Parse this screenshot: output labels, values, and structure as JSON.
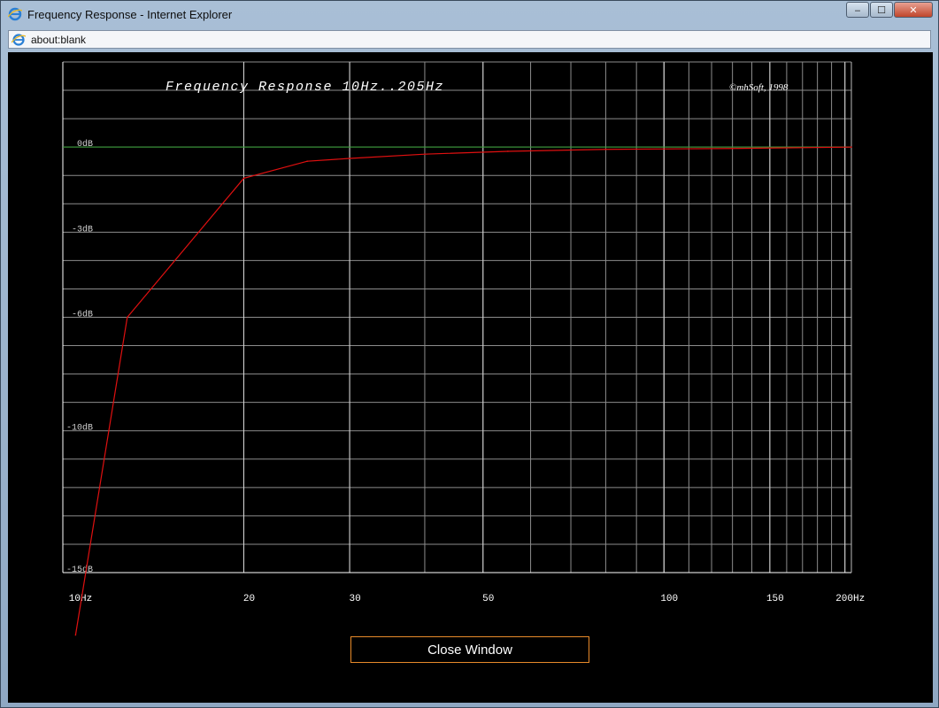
{
  "window": {
    "title": "Frequency Response - Internet Explorer",
    "address": "about:blank",
    "controls": {
      "minimize": "‒",
      "maximize": "☐",
      "close": "✕"
    }
  },
  "close_button": {
    "label": "Close Window"
  },
  "chart_data": {
    "type": "line",
    "title": "Frequency Response 10Hz..205Hz",
    "annotation": "©mhSoft, 1998",
    "x_scale": "log",
    "xlim": [
      10,
      205
    ],
    "ylim": [
      -15,
      3
    ],
    "x_ticks": [
      {
        "value": 10,
        "label": "10Hz"
      },
      {
        "value": 20,
        "label": "20"
      },
      {
        "value": 30,
        "label": "30"
      },
      {
        "value": 50,
        "label": "50"
      },
      {
        "value": 100,
        "label": "100"
      },
      {
        "value": 150,
        "label": "150"
      },
      {
        "value": 200,
        "label": "200Hz"
      }
    ],
    "y_ticks": [
      {
        "value": 0,
        "label": "0dB"
      },
      {
        "value": -3,
        "label": "-3dB"
      },
      {
        "value": -6,
        "label": "-6dB"
      },
      {
        "value": -10,
        "label": "-10dB"
      },
      {
        "value": -15,
        "label": "-15dB"
      }
    ],
    "reference_line": {
      "value": 0,
      "color": "#2e9a2e"
    },
    "grid": true,
    "grid_color": "#8c8c8c",
    "axis_color": "#ffffff",
    "series": [
      {
        "color": "#e01010",
        "x": [
          10.5,
          12.8,
          20,
          25.5,
          30,
          40,
          55,
          80,
          130,
          205
        ],
        "y": [
          -17.2,
          -6,
          -1.1,
          -0.5,
          -0.4,
          -0.25,
          -0.15,
          -0.08,
          -0.05,
          0
        ]
      }
    ]
  }
}
